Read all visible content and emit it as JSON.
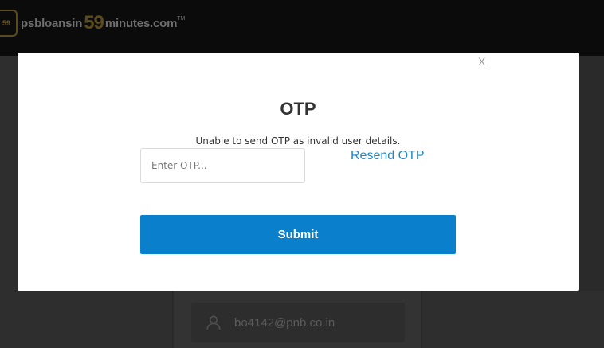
{
  "header": {
    "logo_prefix": "psbloansin",
    "logo_number": "59",
    "logo_suffix": "minutes.com",
    "logo_tm": "TM",
    "logo_mark_text": "59"
  },
  "background": {
    "email": "bo4142@pnb.co.in"
  },
  "modal": {
    "close_label": "X",
    "title": "OTP",
    "message": "Unable to send OTP as invalid user details.",
    "otp_placeholder": "Enter OTP...",
    "otp_value": "",
    "resend_label": "Resend OTP",
    "submit_label": "Submit"
  },
  "colors": {
    "accent": "#0a7fcc",
    "link": "#1e88c8",
    "header_bg": "#0b0b0b",
    "overlay_bg": "#2a2a2a"
  },
  "icons": {
    "user": "user-icon"
  }
}
